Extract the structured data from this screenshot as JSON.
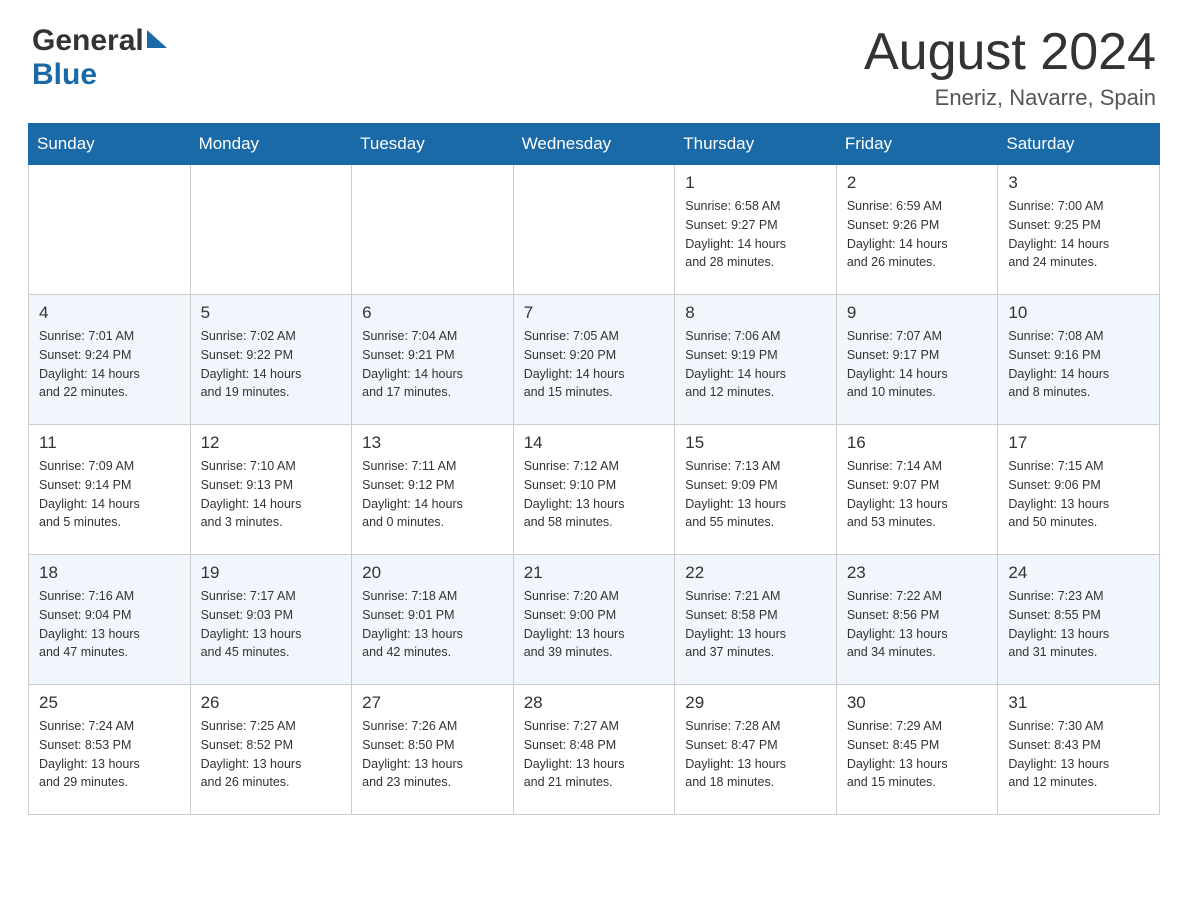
{
  "header": {
    "logo_general": "General",
    "logo_blue": "Blue",
    "month": "August 2024",
    "location": "Eneriz, Navarre, Spain"
  },
  "weekdays": [
    "Sunday",
    "Monday",
    "Tuesday",
    "Wednesday",
    "Thursday",
    "Friday",
    "Saturday"
  ],
  "weeks": [
    [
      {
        "day": "",
        "info": ""
      },
      {
        "day": "",
        "info": ""
      },
      {
        "day": "",
        "info": ""
      },
      {
        "day": "",
        "info": ""
      },
      {
        "day": "1",
        "info": "Sunrise: 6:58 AM\nSunset: 9:27 PM\nDaylight: 14 hours\nand 28 minutes."
      },
      {
        "day": "2",
        "info": "Sunrise: 6:59 AM\nSunset: 9:26 PM\nDaylight: 14 hours\nand 26 minutes."
      },
      {
        "day": "3",
        "info": "Sunrise: 7:00 AM\nSunset: 9:25 PM\nDaylight: 14 hours\nand 24 minutes."
      }
    ],
    [
      {
        "day": "4",
        "info": "Sunrise: 7:01 AM\nSunset: 9:24 PM\nDaylight: 14 hours\nand 22 minutes."
      },
      {
        "day": "5",
        "info": "Sunrise: 7:02 AM\nSunset: 9:22 PM\nDaylight: 14 hours\nand 19 minutes."
      },
      {
        "day": "6",
        "info": "Sunrise: 7:04 AM\nSunset: 9:21 PM\nDaylight: 14 hours\nand 17 minutes."
      },
      {
        "day": "7",
        "info": "Sunrise: 7:05 AM\nSunset: 9:20 PM\nDaylight: 14 hours\nand 15 minutes."
      },
      {
        "day": "8",
        "info": "Sunrise: 7:06 AM\nSunset: 9:19 PM\nDaylight: 14 hours\nand 12 minutes."
      },
      {
        "day": "9",
        "info": "Sunrise: 7:07 AM\nSunset: 9:17 PM\nDaylight: 14 hours\nand 10 minutes."
      },
      {
        "day": "10",
        "info": "Sunrise: 7:08 AM\nSunset: 9:16 PM\nDaylight: 14 hours\nand 8 minutes."
      }
    ],
    [
      {
        "day": "11",
        "info": "Sunrise: 7:09 AM\nSunset: 9:14 PM\nDaylight: 14 hours\nand 5 minutes."
      },
      {
        "day": "12",
        "info": "Sunrise: 7:10 AM\nSunset: 9:13 PM\nDaylight: 14 hours\nand 3 minutes."
      },
      {
        "day": "13",
        "info": "Sunrise: 7:11 AM\nSunset: 9:12 PM\nDaylight: 14 hours\nand 0 minutes."
      },
      {
        "day": "14",
        "info": "Sunrise: 7:12 AM\nSunset: 9:10 PM\nDaylight: 13 hours\nand 58 minutes."
      },
      {
        "day": "15",
        "info": "Sunrise: 7:13 AM\nSunset: 9:09 PM\nDaylight: 13 hours\nand 55 minutes."
      },
      {
        "day": "16",
        "info": "Sunrise: 7:14 AM\nSunset: 9:07 PM\nDaylight: 13 hours\nand 53 minutes."
      },
      {
        "day": "17",
        "info": "Sunrise: 7:15 AM\nSunset: 9:06 PM\nDaylight: 13 hours\nand 50 minutes."
      }
    ],
    [
      {
        "day": "18",
        "info": "Sunrise: 7:16 AM\nSunset: 9:04 PM\nDaylight: 13 hours\nand 47 minutes."
      },
      {
        "day": "19",
        "info": "Sunrise: 7:17 AM\nSunset: 9:03 PM\nDaylight: 13 hours\nand 45 minutes."
      },
      {
        "day": "20",
        "info": "Sunrise: 7:18 AM\nSunset: 9:01 PM\nDaylight: 13 hours\nand 42 minutes."
      },
      {
        "day": "21",
        "info": "Sunrise: 7:20 AM\nSunset: 9:00 PM\nDaylight: 13 hours\nand 39 minutes."
      },
      {
        "day": "22",
        "info": "Sunrise: 7:21 AM\nSunset: 8:58 PM\nDaylight: 13 hours\nand 37 minutes."
      },
      {
        "day": "23",
        "info": "Sunrise: 7:22 AM\nSunset: 8:56 PM\nDaylight: 13 hours\nand 34 minutes."
      },
      {
        "day": "24",
        "info": "Sunrise: 7:23 AM\nSunset: 8:55 PM\nDaylight: 13 hours\nand 31 minutes."
      }
    ],
    [
      {
        "day": "25",
        "info": "Sunrise: 7:24 AM\nSunset: 8:53 PM\nDaylight: 13 hours\nand 29 minutes."
      },
      {
        "day": "26",
        "info": "Sunrise: 7:25 AM\nSunset: 8:52 PM\nDaylight: 13 hours\nand 26 minutes."
      },
      {
        "day": "27",
        "info": "Sunrise: 7:26 AM\nSunset: 8:50 PM\nDaylight: 13 hours\nand 23 minutes."
      },
      {
        "day": "28",
        "info": "Sunrise: 7:27 AM\nSunset: 8:48 PM\nDaylight: 13 hours\nand 21 minutes."
      },
      {
        "day": "29",
        "info": "Sunrise: 7:28 AM\nSunset: 8:47 PM\nDaylight: 13 hours\nand 18 minutes."
      },
      {
        "day": "30",
        "info": "Sunrise: 7:29 AM\nSunset: 8:45 PM\nDaylight: 13 hours\nand 15 minutes."
      },
      {
        "day": "31",
        "info": "Sunrise: 7:30 AM\nSunset: 8:43 PM\nDaylight: 13 hours\nand 12 minutes."
      }
    ]
  ]
}
